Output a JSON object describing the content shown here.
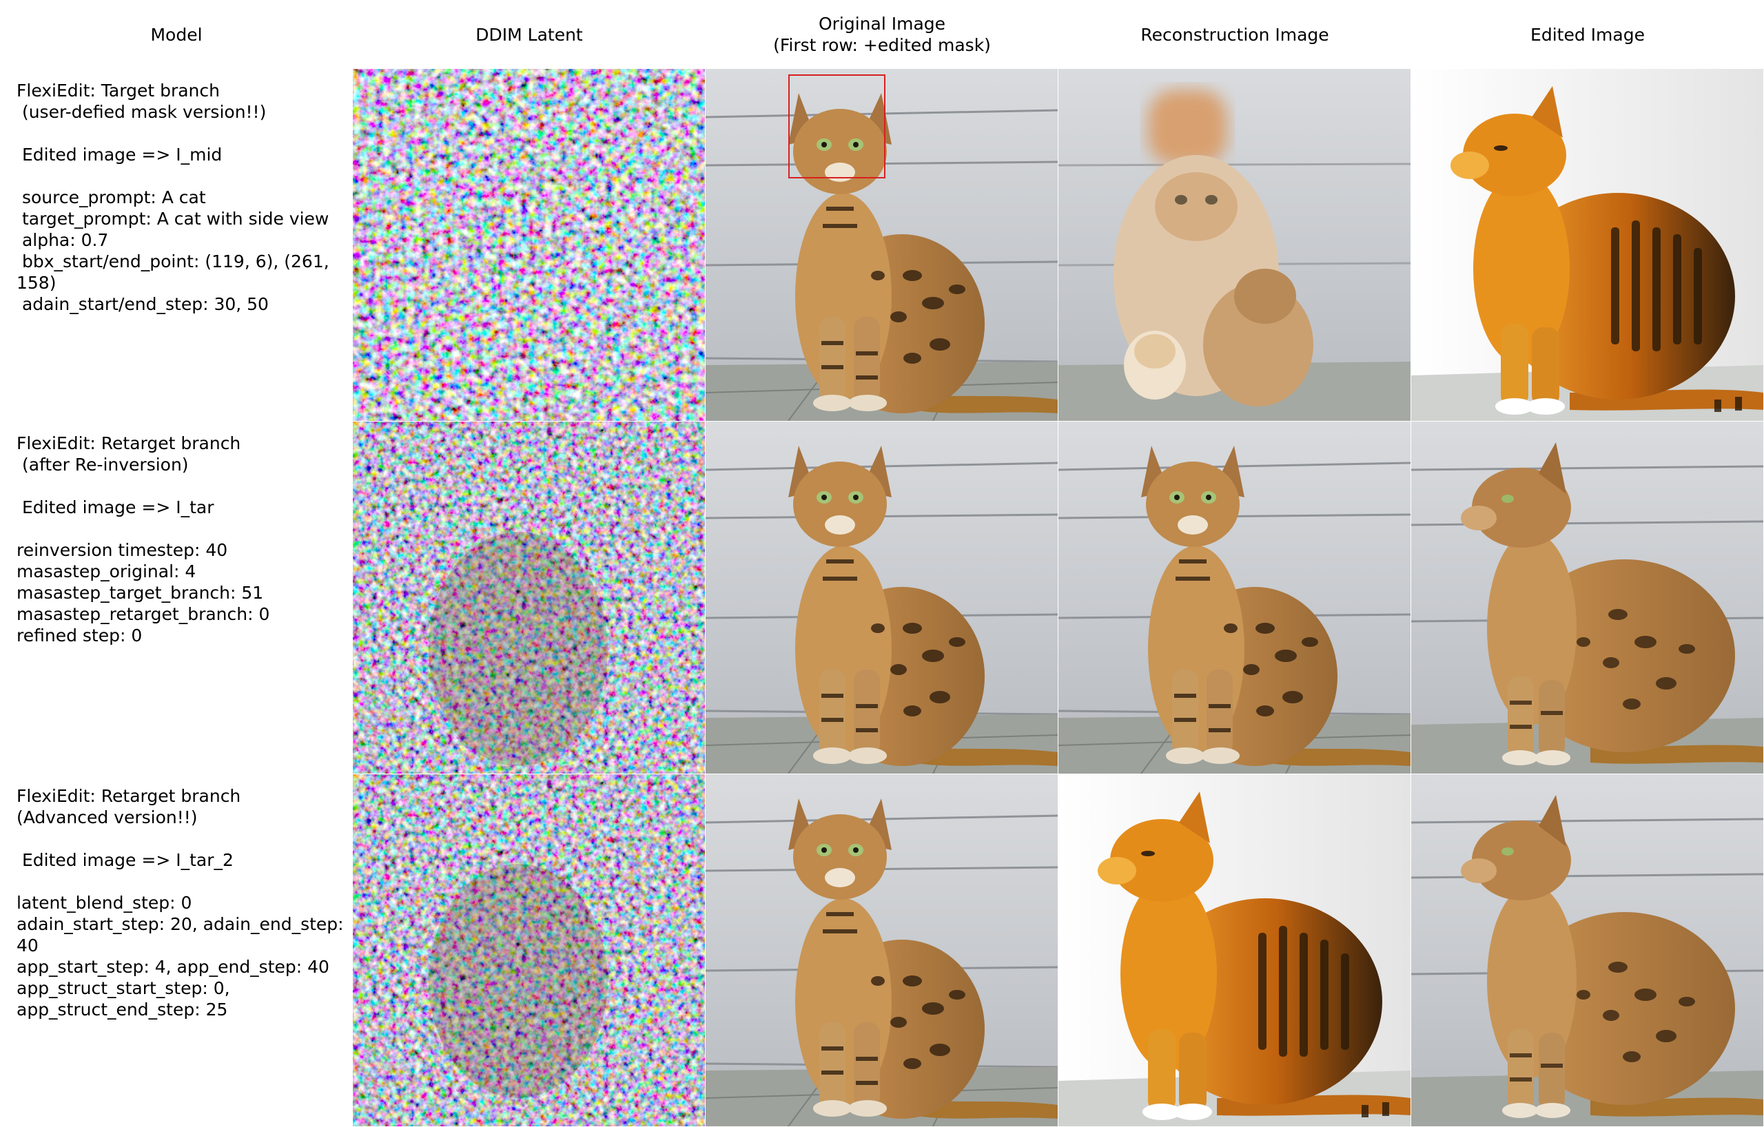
{
  "headers": {
    "model": "Model",
    "ddim": "DDIM Latent",
    "original": "Original Image\n(First row: +edited mask)",
    "reconstruction": "Reconstruction Image",
    "edited": "Edited Image"
  },
  "rows": [
    {
      "model_text": "FlexiEdit: Target branch\n (user-defied mask version!!)\n\n Edited image => I_mid\n\n source_prompt: A cat\n target_prompt: A cat with side view\n alpha: 0.7\n bbx_start/end_point: (119, 6), (261, 158)\n adain_start/end_step: 30, 50"
    },
    {
      "model_text": "FlexiEdit: Retarget branch\n (after Re-inversion)\n\n Edited image => I_tar\n\nreinversion timestep: 40\nmasastep_original: 4\nmasastep_target_branch: 51\nmasastep_retarget_branch: 0\nrefined step: 0"
    },
    {
      "model_text": "FlexiEdit: Retarget branch\n(Advanced version!!)\n\n Edited image => I_tar_2\n\nlatent_blend_step: 0\nadain_start_step: 20, adain_end_step: 40\napp_start_step: 4, app_end_step: 40\napp_struct_start_step: 0,\napp_struct_end_step: 25"
    }
  ],
  "colors": {
    "mask_box": "#d82020",
    "wall": "#c9ccd0",
    "floor": "#9a9e98",
    "cat_fur": "#b8834a",
    "cat_orange": "#d8801c",
    "cat_stripes": "#3a2612"
  }
}
